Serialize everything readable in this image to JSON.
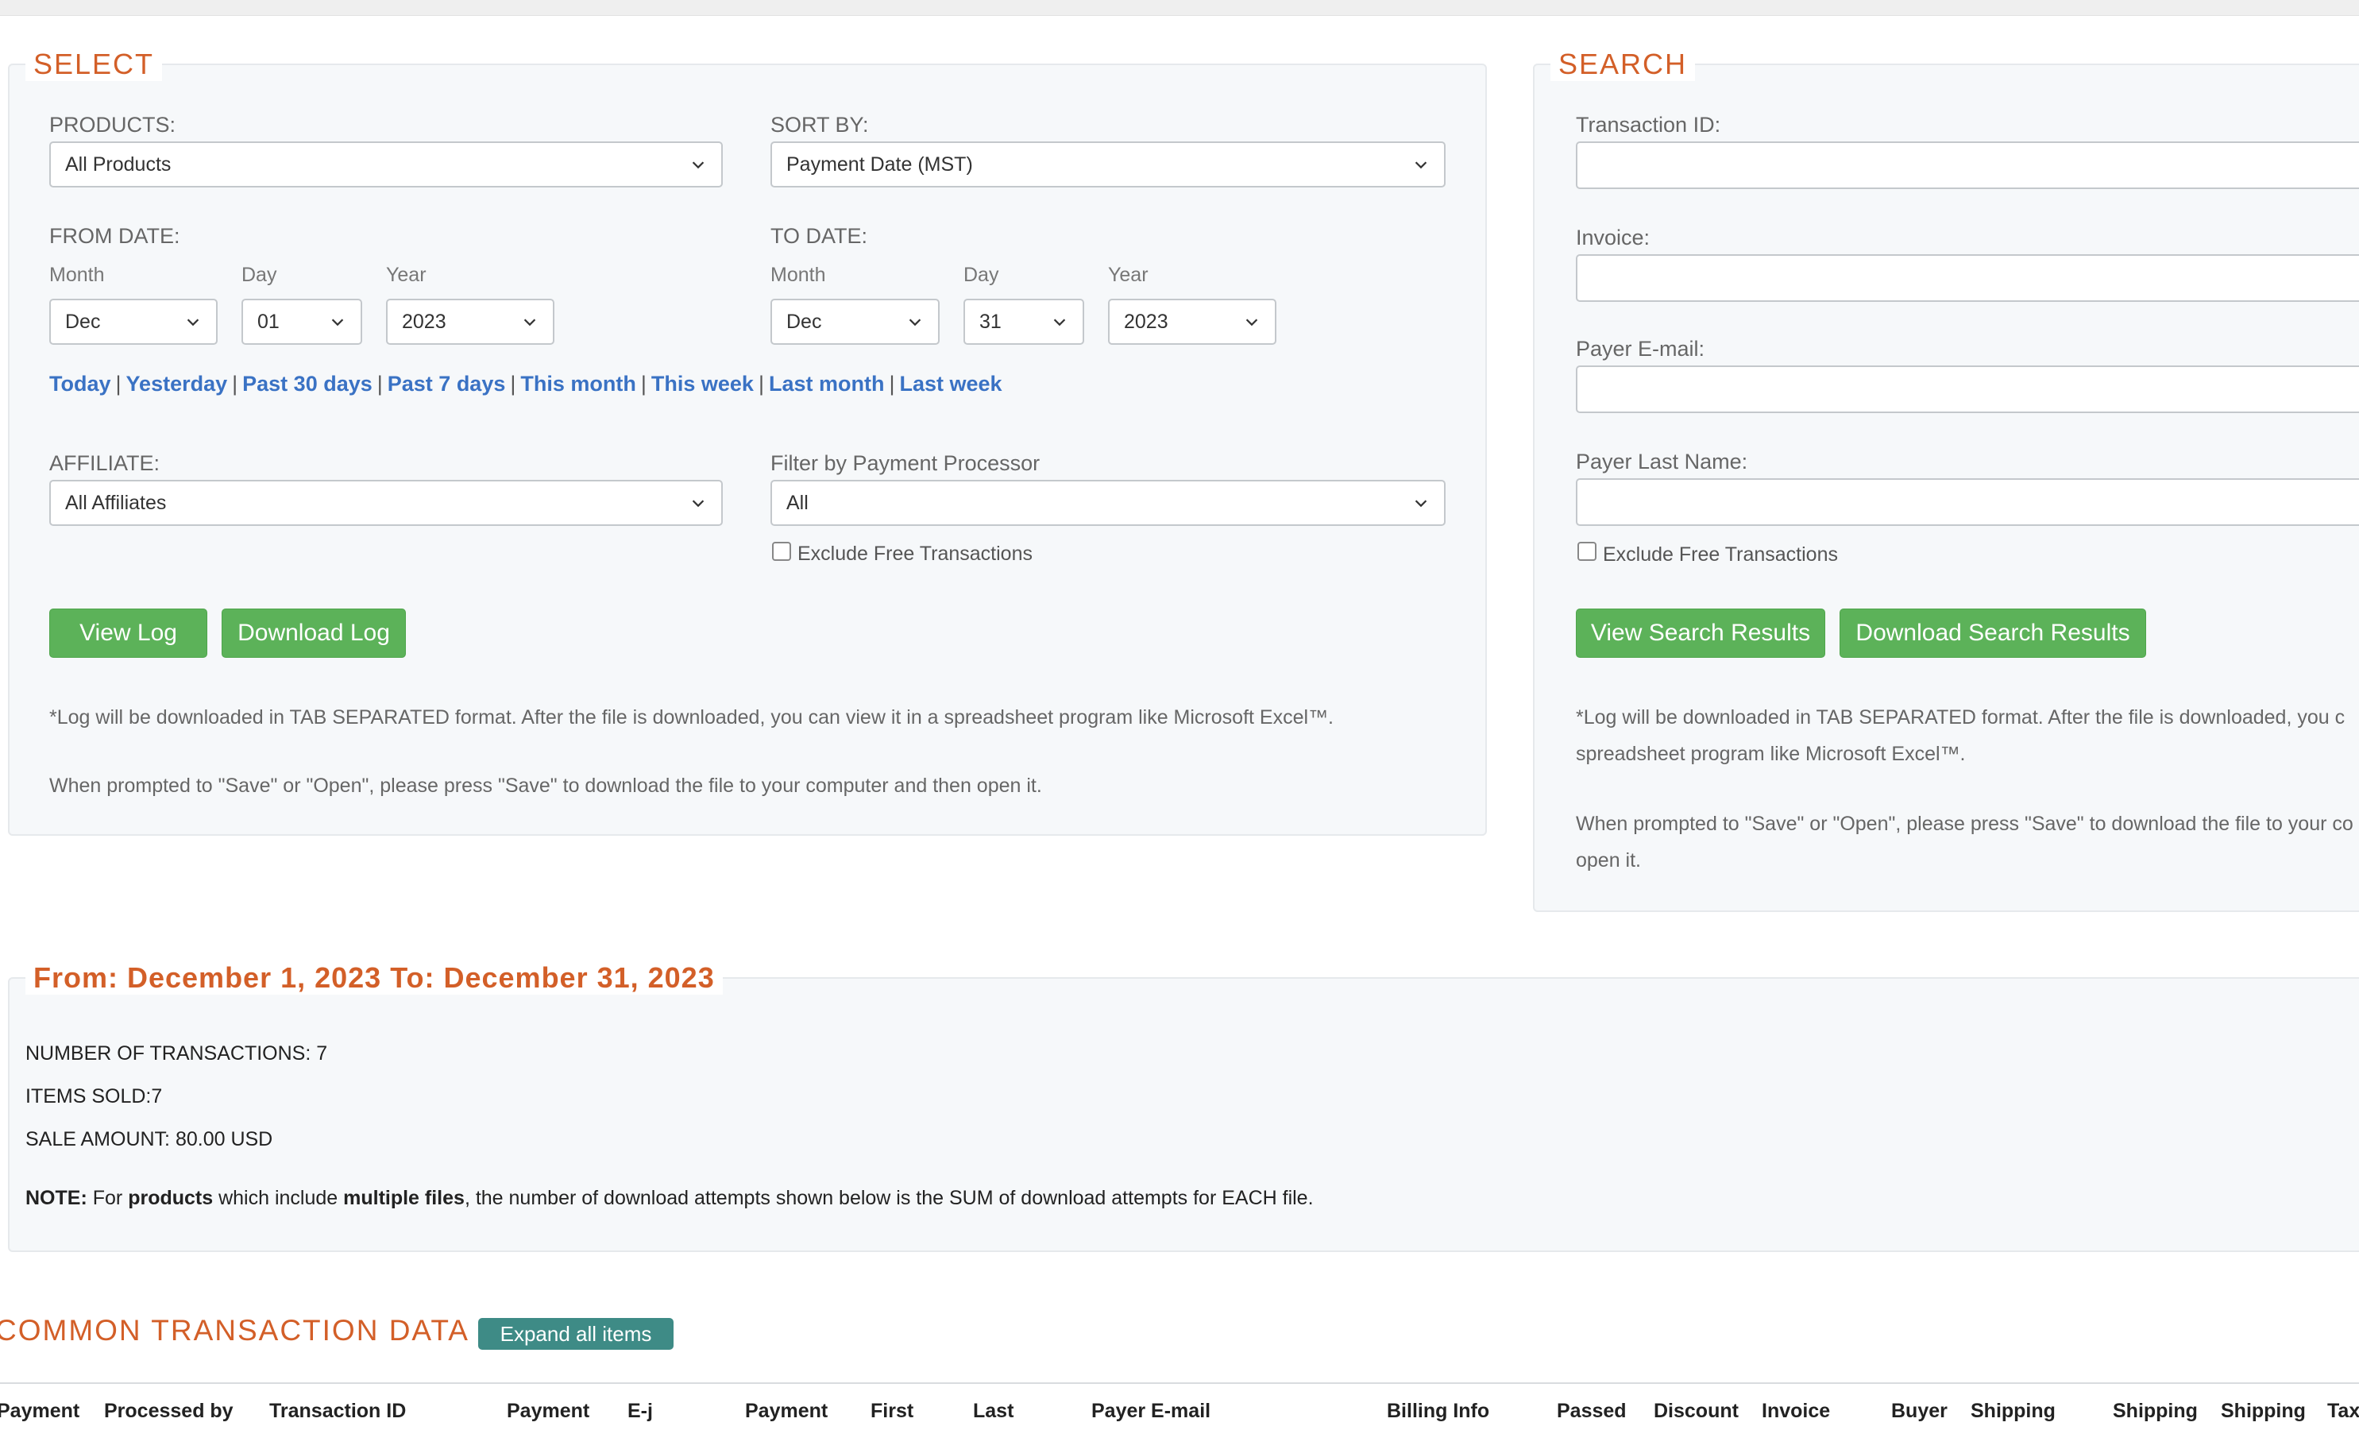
{
  "select_panel": {
    "legend": "SELECT",
    "products_label": "PRODUCTS:",
    "products_value": "All Products",
    "sort_label": "SORT BY:",
    "sort_value": "Payment Date (MST)",
    "from_label": "FROM DATE:",
    "to_label": "TO DATE:",
    "month_label": "Month",
    "day_label": "Day",
    "year_label": "Year",
    "from_month": "Dec",
    "from_day": "01",
    "from_year": "2023",
    "to_month": "Dec",
    "to_day": "31",
    "to_year": "2023",
    "quick_links": [
      "Today",
      "Yesterday",
      "Past 30 days",
      "Past 7 days",
      "This month",
      "This week",
      "Last month",
      "Last week"
    ],
    "quick_sep": "|",
    "affiliate_label": "AFFILIATE:",
    "affiliate_value": "All Affiliates",
    "processor_label": "Filter by Payment Processor",
    "processor_value": "All",
    "exclude_free_label": "Exclude Free Transactions",
    "view_log_label": "View Log",
    "download_log_label": "Download Log",
    "note1": "*Log will be downloaded in TAB SEPARATED format. After the file is downloaded, you can view it in a spreadsheet program like Microsoft Excel™.",
    "note2": "When prompted to \"Save\" or \"Open\", please press \"Save\" to download the file to your computer and then open it."
  },
  "search_panel": {
    "legend": "SEARCH",
    "transaction_id_label": "Transaction ID:",
    "invoice_label": "Invoice:",
    "payer_email_label": "Payer E-mail:",
    "payer_last_name_label": "Payer Last Name:",
    "exclude_free_label": "Exclude Free Transactions",
    "view_results_label": "View Search Results",
    "download_results_label": "Download Search Results",
    "note1_line1": "*Log will be downloaded in TAB SEPARATED format. After the file is downloaded, you c",
    "note1_line2": "spreadsheet program like Microsoft Excel™.",
    "note2_line1": "When prompted to \"Save\" or \"Open\", please press \"Save\" to download the file to your co",
    "note2_line2": "open it."
  },
  "summary": {
    "legend": "From: December 1, 2023 To: December 31, 2023",
    "num_transactions": "NUMBER OF TRANSACTIONS: 7",
    "items_sold": "ITEMS SOLD:7",
    "sale_amount": "SALE AMOUNT: 80.00 USD",
    "note_label": "NOTE:",
    "note_t1": " For ",
    "note_b1": "products",
    "note_t2": " which include ",
    "note_b2": "multiple files",
    "note_t3": ", the number of download attempts shown below is the SUM of download attempts for EACH file."
  },
  "common": {
    "title": "COMMON TRANSACTION DATA",
    "expand_label": "Expand all items",
    "columns": [
      "Payment",
      "Processed by",
      "Transaction ID",
      "Payment",
      "E-j",
      "Payment",
      "First",
      "Last",
      "Payer E-mail",
      "Billing Info",
      "Passed",
      "Discount",
      "Invoice",
      "Buyer",
      "Shipping",
      "Shipping",
      "Shipping",
      "Tax"
    ]
  },
  "colors": {
    "accent": "#d35f28",
    "link": "#3a72c4",
    "button_green": "#5cb259",
    "button_teal": "#3e8b86"
  }
}
